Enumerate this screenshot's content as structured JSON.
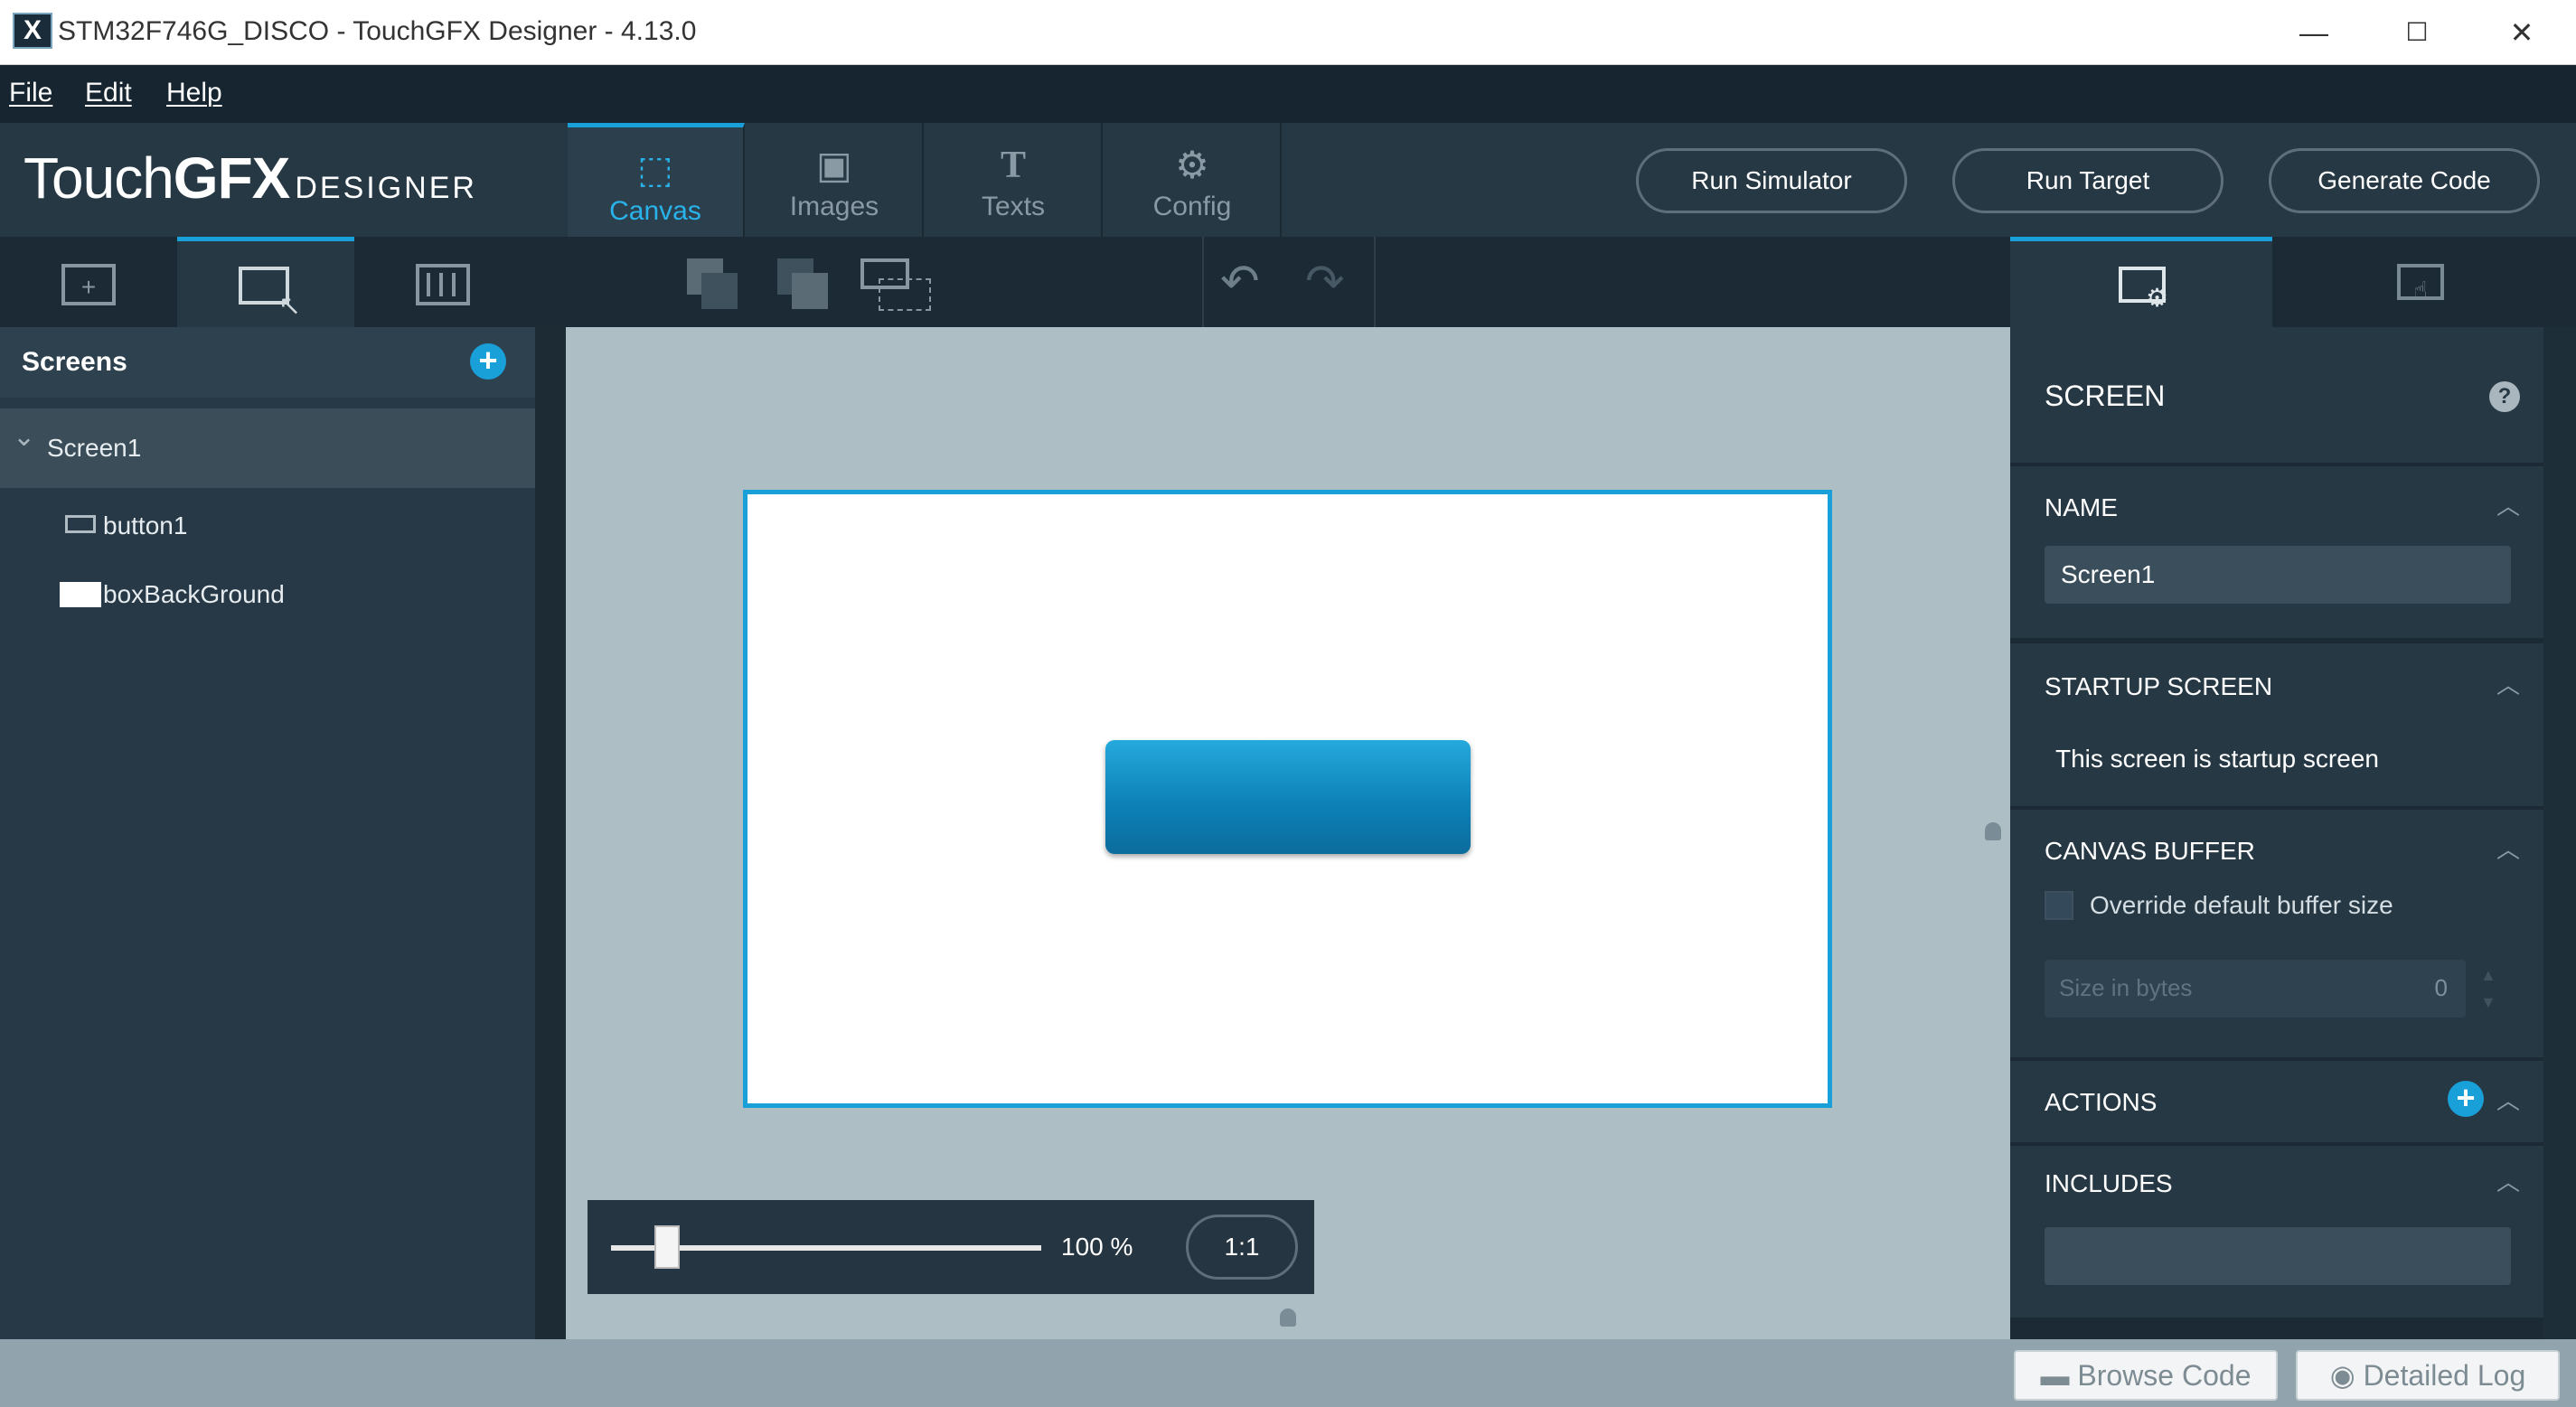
{
  "window": {
    "title": "STM32F746G_DISCO - TouchGFX Designer - 4.13.0",
    "app_icon": "X",
    "minimize": "—",
    "maximize": "☐",
    "close": "✕"
  },
  "menu": {
    "items": [
      "File",
      "Edit",
      "Help"
    ]
  },
  "header": {
    "logo_brand_light": "Touch",
    "logo_brand_bold": "GFX",
    "logo_sub": "DESIGNER",
    "tabs": [
      {
        "label": "Canvas",
        "icon": "canvas-icon",
        "glyph": "⬚"
      },
      {
        "label": "Images",
        "icon": "images-icon",
        "glyph": "▣"
      },
      {
        "label": "Texts",
        "icon": "texts-icon",
        "glyph": "T"
      },
      {
        "label": "Config",
        "icon": "config-icon",
        "glyph": "⚙"
      }
    ],
    "buttons": {
      "run_simulator": "Run Simulator",
      "run_target": "Run Target",
      "generate_code": "Generate Code"
    }
  },
  "toolbar": {
    "undo": "↶",
    "redo": "↷"
  },
  "left_panel": {
    "screens_title": "Screens",
    "add": "+",
    "tree": [
      {
        "label": "Screen1",
        "expand": "⌄"
      },
      {
        "label": "button1"
      },
      {
        "label": "boxBackGround"
      }
    ]
  },
  "canvas": {
    "zoom_label": "100 %",
    "zoom_level": 100,
    "zoom_slider_fraction": 0.13,
    "reset_zoom": "1:1"
  },
  "properties": {
    "header": "SCREEN",
    "help": "?",
    "name_title": "NAME",
    "name_value": "Screen1",
    "startup_title": "STARTUP SCREEN",
    "startup_text": "This screen is startup screen",
    "canvas_buffer_title": "CANVAS BUFFER",
    "override_label": "Override default buffer size",
    "size_placeholder": "Size in bytes",
    "size_value": "0",
    "actions_title": "ACTIONS",
    "includes_title": "INCLUDES",
    "collapse": "︿",
    "add": "+"
  },
  "status_bar": {
    "browse_code": "Browse Code",
    "detailed_log": "Detailed Log"
  },
  "colors": {
    "accent": "#1aa0d8",
    "panel": "#263844",
    "canvas_bg": "#adbec5"
  }
}
